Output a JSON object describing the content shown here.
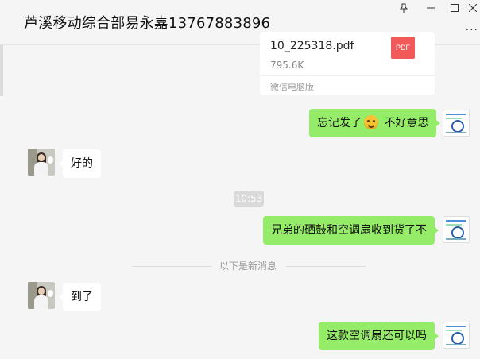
{
  "window": {
    "title": "芦溪移动综合部易永嘉13767883896",
    "controls": {
      "pin": "pin-icon",
      "minimize": "minimize-icon",
      "maximize": "maximize-icon",
      "close": "close-icon",
      "more": "more-icon"
    }
  },
  "file_card": {
    "filename": "10_225318.pdf",
    "badge": "PDF",
    "size": "795.6K",
    "source": "微信电脑版"
  },
  "messages": [
    {
      "id": "m1",
      "from": "me",
      "text_before": "忘记发了",
      "emoji": "grin-emoji",
      "text_after": " 不好意思"
    },
    {
      "id": "m2",
      "from": "other",
      "text": "好的"
    },
    {
      "id": "m3",
      "from": "me",
      "text": "兄弟的硒鼓和空调扇收到货了不"
    },
    {
      "id": "m4",
      "from": "other",
      "text": "到了"
    },
    {
      "id": "m5",
      "from": "me",
      "text": "这款空调扇还可以吗"
    }
  ],
  "timestamp": "10:53",
  "new_messages_divider": "以下是新消息",
  "colors": {
    "outgoing_bubble": "#95ec69",
    "incoming_bubble": "#ffffff",
    "background": "#f5f5f5",
    "pdf_badge": "#f25a5a"
  }
}
